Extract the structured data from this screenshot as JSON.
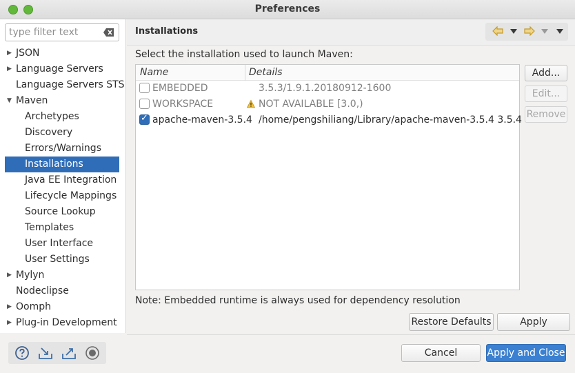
{
  "window": {
    "title": "Preferences"
  },
  "filter": {
    "placeholder": "type filter text"
  },
  "tree": {
    "json": "JSON",
    "language_servers": "Language Servers",
    "language_servers_sts": "Language Servers STS",
    "maven": "Maven",
    "archetypes": "Archetypes",
    "discovery": "Discovery",
    "errors_warnings": "Errors/Warnings",
    "installations": "Installations",
    "java_ee": "Java EE Integration",
    "lifecycle": "Lifecycle Mappings",
    "source_lookup": "Source Lookup",
    "templates": "Templates",
    "user_interface": "User Interface",
    "user_settings": "User Settings",
    "mylyn": "Mylyn",
    "nodeclipse": "Nodeclipse",
    "oomph": "Oomph",
    "plugin_dev": "Plug-in Development"
  },
  "page": {
    "title": "Installations",
    "instruction": "Select the installation used to launch Maven:",
    "note": "Note: Embedded runtime is always used for dependency resolution"
  },
  "table": {
    "col_name": "Name",
    "col_details": "Details",
    "rows": [
      {
        "name": "EMBEDDED",
        "details": "3.5.3/1.9.1.20180912-1600",
        "checked": false
      },
      {
        "name": "WORKSPACE",
        "details": "NOT AVAILABLE [3.0,)",
        "checked": false
      },
      {
        "name": "apache-maven-3.5.4",
        "details": "/home/pengshiliang/Library/apache-maven-3.5.4 3.5.4",
        "checked": true
      }
    ]
  },
  "buttons": {
    "add": "Add...",
    "edit": "Edit...",
    "remove": "Remove",
    "restore": "Restore Defaults",
    "apply": "Apply",
    "cancel": "Cancel",
    "apply_close": "Apply and Close"
  },
  "colors": {
    "accent": "#2f6db8",
    "primary_button": "#3b80d1"
  }
}
